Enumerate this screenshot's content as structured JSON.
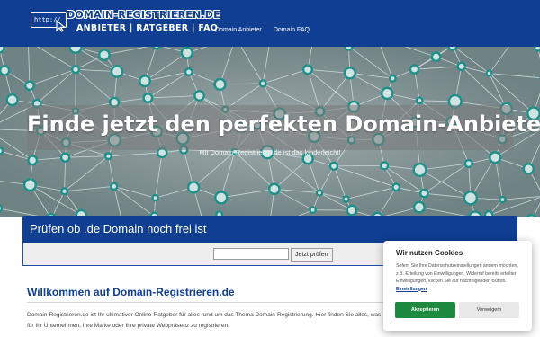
{
  "header": {
    "logo_badge": "http://",
    "logo_title": "DOMAIN-REGISTRIEREN.DE",
    "logo_subtitle": "ANBIETER | RATGEBER | FAQ",
    "nav": [
      "Domain Anbieter",
      "Domain FAQ"
    ]
  },
  "hero": {
    "title": "Finde jetzt den perfekten Domain-Anbieter",
    "subtitle": "Mit Domain-Registrieren.de ist das kinderleicht!"
  },
  "domain_check": {
    "title": "Prüfen ob .de Domain noch frei ist",
    "input_value": "",
    "button_label": "Jetzt prüfen"
  },
  "main": {
    "title": "Willkommen auf Domain-Registrieren.de",
    "text_line1": "Domain-Registrieren.de ist Ihr ultimativer Online-Ratgeber für alles rund um das Thema Domain-Registrierung. Hier finden Sie alles, was",
    "text_line2": "für Ihr Unternehmen, Ihre Marke oder Ihre private Webpräsenz zu registrieren."
  },
  "cookie": {
    "title": "Wir nutzen Cookies",
    "text": "Sofern Sie Ihre Datenschutzeinstellungen ändern möchten, z.B. Erteilung von Einwilligungen, Widerruf bereits erteilter Einwilligungen, klicken Sie auf nachfolgenden Button.",
    "settings_link": "Einstellungen",
    "accept_label": "Akzeptieren",
    "decline_label": "Verweigern"
  },
  "colors": {
    "brand_blue": "#0f3e93",
    "accept_green": "#1e8a3f",
    "network_node": "#1f8f8a"
  },
  "icons": [
    "cursor-icon",
    "network-background"
  ]
}
